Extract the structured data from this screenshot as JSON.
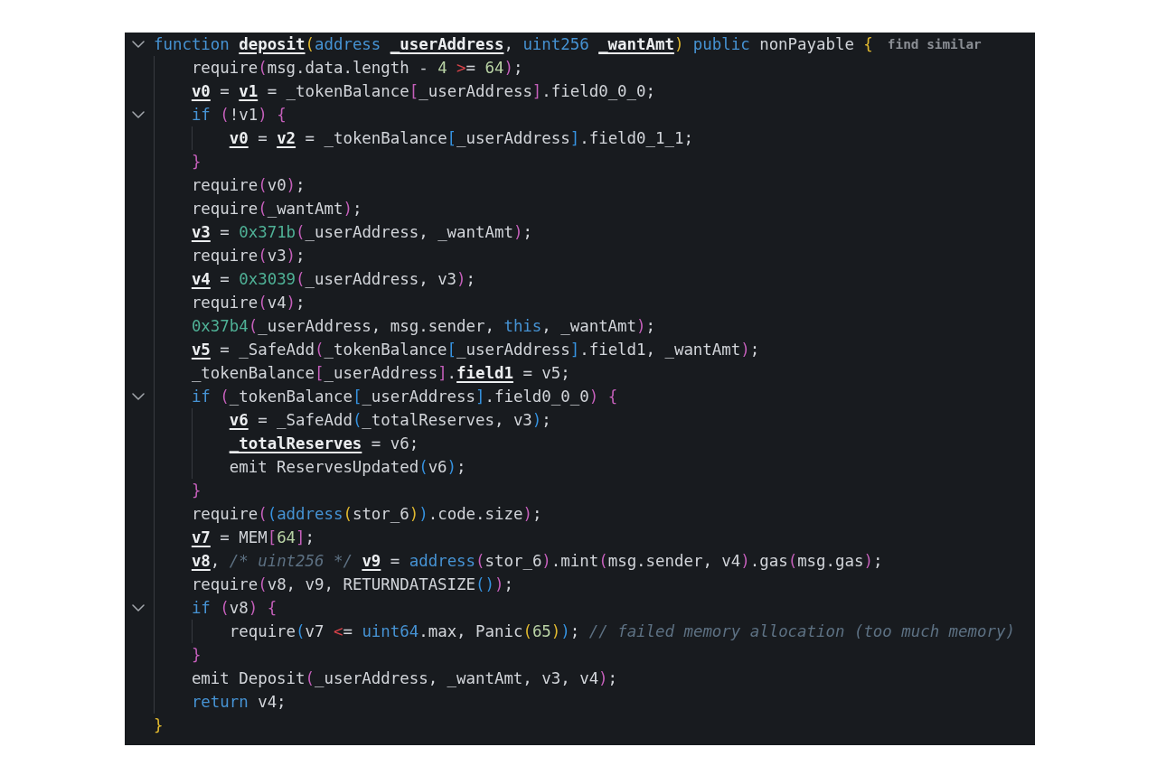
{
  "editor": {
    "lines": [
      {
        "expanded": true,
        "lens": "find similar",
        "tokens": [
          {
            "text": "function ",
            "kind": "keyword"
          },
          {
            "text": "deposit",
            "kind": "decl"
          },
          {
            "text": "(",
            "kind": "open"
          },
          {
            "text": "address ",
            "kind": "keyword"
          },
          {
            "text": "_userAddress",
            "kind": "decl"
          },
          {
            "text": ", ",
            "kind": "plain"
          },
          {
            "text": "uint256 ",
            "kind": "keyword"
          },
          {
            "text": "_wantAmt",
            "kind": "decl"
          },
          {
            "text": ")",
            "kind": "close"
          },
          {
            "text": " public",
            "kind": "keyword"
          },
          {
            "text": " nonPayable ",
            "kind": "plain"
          },
          {
            "text": "{",
            "kind": "open"
          }
        ],
        "children": [
          {
            "tokens": [
              {
                "text": "require",
                "kind": "plain"
              },
              {
                "text": "(",
                "kind": "open"
              },
              {
                "text": "msg.data.length - ",
                "kind": "plain"
              },
              {
                "text": "4 ",
                "kind": "number"
              },
              {
                "text": ">",
                "kind": "mismatch"
              },
              {
                "text": "= ",
                "kind": "plain"
              },
              {
                "text": "64",
                "kind": "number"
              },
              {
                "text": ")",
                "kind": "close"
              },
              {
                "text": ";",
                "kind": "plain"
              }
            ]
          },
          {
            "tokens": [
              {
                "text": "v0",
                "kind": "decl"
              },
              {
                "text": " = ",
                "kind": "plain"
              },
              {
                "text": "v1",
                "kind": "decl"
              },
              {
                "text": " = _tokenBalance",
                "kind": "plain"
              },
              {
                "text": "[",
                "kind": "open"
              },
              {
                "text": "_userAddress",
                "kind": "plain"
              },
              {
                "text": "]",
                "kind": "close"
              },
              {
                "text": ".field0_0_0;",
                "kind": "plain"
              }
            ]
          },
          {
            "expanded": true,
            "tokens": [
              {
                "text": "if ",
                "kind": "keyword"
              },
              {
                "text": "(",
                "kind": "open"
              },
              {
                "text": "!v1",
                "kind": "plain"
              },
              {
                "text": ")",
                "kind": "close"
              },
              {
                "text": " {",
                "kind": "open"
              }
            ],
            "children": [
              {
                "tokens": [
                  {
                    "text": "v0",
                    "kind": "decl"
                  },
                  {
                    "text": " = ",
                    "kind": "plain"
                  },
                  {
                    "text": "v2",
                    "kind": "decl"
                  },
                  {
                    "text": " = _tokenBalance",
                    "kind": "plain"
                  },
                  {
                    "text": "[",
                    "kind": "open"
                  },
                  {
                    "text": "_userAddress",
                    "kind": "plain"
                  },
                  {
                    "text": "]",
                    "kind": "close"
                  },
                  {
                    "text": ".field0_1_1;",
                    "kind": "plain"
                  }
                ]
              }
            ]
          },
          {
            "tokens": [
              {
                "text": "}",
                "kind": "close"
              }
            ]
          },
          {
            "tokens": [
              {
                "text": "require",
                "kind": "plain"
              },
              {
                "text": "(",
                "kind": "open"
              },
              {
                "text": "v0",
                "kind": "plain"
              },
              {
                "text": ")",
                "kind": "close"
              },
              {
                "text": ";",
                "kind": "plain"
              }
            ]
          },
          {
            "tokens": [
              {
                "text": "require",
                "kind": "plain"
              },
              {
                "text": "(",
                "kind": "open"
              },
              {
                "text": "_wantAmt",
                "kind": "plain"
              },
              {
                "text": ")",
                "kind": "close"
              },
              {
                "text": ";",
                "kind": "plain"
              }
            ]
          },
          {
            "tokens": [
              {
                "text": "v3",
                "kind": "decl"
              },
              {
                "text": " = ",
                "kind": "plain"
              },
              {
                "text": "0x371b",
                "kind": "call"
              },
              {
                "text": "(",
                "kind": "open"
              },
              {
                "text": "_userAddress, _wantAmt",
                "kind": "plain"
              },
              {
                "text": ")",
                "kind": "close"
              },
              {
                "text": ";",
                "kind": "plain"
              }
            ]
          },
          {
            "tokens": [
              {
                "text": "require",
                "kind": "plain"
              },
              {
                "text": "(",
                "kind": "open"
              },
              {
                "text": "v3",
                "kind": "plain"
              },
              {
                "text": ")",
                "kind": "close"
              },
              {
                "text": ";",
                "kind": "plain"
              }
            ]
          },
          {
            "tokens": [
              {
                "text": "v4",
                "kind": "decl"
              },
              {
                "text": " = ",
                "kind": "plain"
              },
              {
                "text": "0x3039",
                "kind": "call"
              },
              {
                "text": "(",
                "kind": "open"
              },
              {
                "text": "_userAddress, v3",
                "kind": "plain"
              },
              {
                "text": ")",
                "kind": "close"
              },
              {
                "text": ";",
                "kind": "plain"
              }
            ]
          },
          {
            "tokens": [
              {
                "text": "require",
                "kind": "plain"
              },
              {
                "text": "(",
                "kind": "open"
              },
              {
                "text": "v4",
                "kind": "plain"
              },
              {
                "text": ")",
                "kind": "close"
              },
              {
                "text": ";",
                "kind": "plain"
              }
            ]
          },
          {
            "tokens": [
              {
                "text": "0x37b4",
                "kind": "call"
              },
              {
                "text": "(",
                "kind": "open"
              },
              {
                "text": "_userAddress, msg.sender, ",
                "kind": "plain"
              },
              {
                "text": "this",
                "kind": "keyword"
              },
              {
                "text": ", _wantAmt",
                "kind": "plain"
              },
              {
                "text": ")",
                "kind": "close"
              },
              {
                "text": ";",
                "kind": "plain"
              }
            ]
          },
          {
            "tokens": [
              {
                "text": "v5",
                "kind": "decl"
              },
              {
                "text": " = _SafeAdd",
                "kind": "plain"
              },
              {
                "text": "(",
                "kind": "open"
              },
              {
                "text": "_tokenBalance",
                "kind": "plain"
              },
              {
                "text": "[",
                "kind": "open"
              },
              {
                "text": "_userAddress",
                "kind": "plain"
              },
              {
                "text": "]",
                "kind": "close"
              },
              {
                "text": ".field1, _wantAmt",
                "kind": "plain"
              },
              {
                "text": ")",
                "kind": "close"
              },
              {
                "text": ";",
                "kind": "plain"
              }
            ]
          },
          {
            "tokens": [
              {
                "text": "_tokenBalance",
                "kind": "plain"
              },
              {
                "text": "[",
                "kind": "open"
              },
              {
                "text": "_userAddress",
                "kind": "plain"
              },
              {
                "text": "]",
                "kind": "close"
              },
              {
                "text": ".",
                "kind": "plain"
              },
              {
                "text": "field1",
                "kind": "decl"
              },
              {
                "text": " = v5;",
                "kind": "plain"
              }
            ]
          },
          {
            "expanded": true,
            "tokens": [
              {
                "text": "if ",
                "kind": "keyword"
              },
              {
                "text": "(",
                "kind": "open"
              },
              {
                "text": "_tokenBalance",
                "kind": "plain"
              },
              {
                "text": "[",
                "kind": "open"
              },
              {
                "text": "_userAddress",
                "kind": "plain"
              },
              {
                "text": "]",
                "kind": "close"
              },
              {
                "text": ".field0_0_0",
                "kind": "plain"
              },
              {
                "text": ")",
                "kind": "close"
              },
              {
                "text": " {",
                "kind": "open"
              }
            ],
            "children": [
              {
                "tokens": [
                  {
                    "text": "v6",
                    "kind": "decl"
                  },
                  {
                    "text": " = _SafeAdd",
                    "kind": "plain"
                  },
                  {
                    "text": "(",
                    "kind": "open"
                  },
                  {
                    "text": "_totalReserves, v3",
                    "kind": "plain"
                  },
                  {
                    "text": ")",
                    "kind": "close"
                  },
                  {
                    "text": ";",
                    "kind": "plain"
                  }
                ]
              },
              {
                "tokens": [
                  {
                    "text": "_totalReserves",
                    "kind": "decl"
                  },
                  {
                    "text": " = v6;",
                    "kind": "plain"
                  }
                ]
              },
              {
                "tokens": [
                  {
                    "text": "emit ReservesUpdated",
                    "kind": "plain"
                  },
                  {
                    "text": "(",
                    "kind": "open"
                  },
                  {
                    "text": "v6",
                    "kind": "plain"
                  },
                  {
                    "text": ")",
                    "kind": "close"
                  },
                  {
                    "text": ";",
                    "kind": "plain"
                  }
                ]
              }
            ]
          },
          {
            "tokens": [
              {
                "text": "}",
                "kind": "close"
              }
            ]
          },
          {
            "tokens": [
              {
                "text": "require",
                "kind": "plain"
              },
              {
                "text": "(",
                "kind": "open"
              },
              {
                "text": "(",
                "kind": "open"
              },
              {
                "text": "address",
                "kind": "keyword"
              },
              {
                "text": "(",
                "kind": "open"
              },
              {
                "text": "stor_6",
                "kind": "plain"
              },
              {
                "text": ")",
                "kind": "close"
              },
              {
                "text": ")",
                "kind": "close"
              },
              {
                "text": ".code.size",
                "kind": "plain"
              },
              {
                "text": ")",
                "kind": "close"
              },
              {
                "text": ";",
                "kind": "plain"
              }
            ]
          },
          {
            "tokens": [
              {
                "text": "v7",
                "kind": "decl"
              },
              {
                "text": " = MEM",
                "kind": "plain"
              },
              {
                "text": "[",
                "kind": "open"
              },
              {
                "text": "64",
                "kind": "number"
              },
              {
                "text": "]",
                "kind": "close"
              },
              {
                "text": ";",
                "kind": "plain"
              }
            ]
          },
          {
            "tokens": [
              {
                "text": "v8",
                "kind": "decl"
              },
              {
                "text": ", ",
                "kind": "plain"
              },
              {
                "text": "/* uint256 */ ",
                "kind": "comment"
              },
              {
                "text": "v9",
                "kind": "decl"
              },
              {
                "text": " = ",
                "kind": "plain"
              },
              {
                "text": "address",
                "kind": "keyword"
              },
              {
                "text": "(",
                "kind": "open"
              },
              {
                "text": "stor_6",
                "kind": "plain"
              },
              {
                "text": ")",
                "kind": "close"
              },
              {
                "text": ".mint",
                "kind": "plain"
              },
              {
                "text": "(",
                "kind": "open"
              },
              {
                "text": "msg.sender, v4",
                "kind": "plain"
              },
              {
                "text": ")",
                "kind": "close"
              },
              {
                "text": ".gas",
                "kind": "plain"
              },
              {
                "text": "(",
                "kind": "open"
              },
              {
                "text": "msg.gas",
                "kind": "plain"
              },
              {
                "text": ")",
                "kind": "close"
              },
              {
                "text": ";",
                "kind": "plain"
              }
            ]
          },
          {
            "tokens": [
              {
                "text": "require",
                "kind": "plain"
              },
              {
                "text": "(",
                "kind": "open"
              },
              {
                "text": "v8, v9, RETURNDATASIZE",
                "kind": "plain"
              },
              {
                "text": "(",
                "kind": "open"
              },
              {
                "text": ")",
                "kind": "close"
              },
              {
                "text": ")",
                "kind": "close"
              },
              {
                "text": ";",
                "kind": "plain"
              }
            ]
          },
          {
            "expanded": true,
            "tokens": [
              {
                "text": "if ",
                "kind": "keyword"
              },
              {
                "text": "(",
                "kind": "open"
              },
              {
                "text": "v8",
                "kind": "plain"
              },
              {
                "text": ")",
                "kind": "close"
              },
              {
                "text": " {",
                "kind": "open"
              }
            ],
            "children": [
              {
                "tokens": [
                  {
                    "text": "require",
                    "kind": "plain"
                  },
                  {
                    "text": "(",
                    "kind": "open"
                  },
                  {
                    "text": "v7 ",
                    "kind": "plain"
                  },
                  {
                    "text": "<",
                    "kind": "mismatch"
                  },
                  {
                    "text": "= ",
                    "kind": "plain"
                  },
                  {
                    "text": "uint64",
                    "kind": "keyword"
                  },
                  {
                    "text": ".max, Panic",
                    "kind": "plain"
                  },
                  {
                    "text": "(",
                    "kind": "open"
                  },
                  {
                    "text": "65",
                    "kind": "number"
                  },
                  {
                    "text": ")",
                    "kind": "close"
                  },
                  {
                    "text": ")",
                    "kind": "close"
                  },
                  {
                    "text": "; ",
                    "kind": "plain"
                  },
                  {
                    "text": "// failed memory allocation (too much memory)",
                    "kind": "comment"
                  }
                ]
              }
            ]
          },
          {
            "tokens": [
              {
                "text": "}",
                "kind": "close"
              }
            ]
          },
          {
            "tokens": [
              {
                "text": "emit Deposit",
                "kind": "plain"
              },
              {
                "text": "(",
                "kind": "open"
              },
              {
                "text": "_userAddress, _wantAmt, v3, v4",
                "kind": "plain"
              },
              {
                "text": ")",
                "kind": "close"
              },
              {
                "text": ";",
                "kind": "plain"
              }
            ]
          },
          {
            "tokens": [
              {
                "text": "return",
                "kind": "keyword"
              },
              {
                "text": " v4;",
                "kind": "plain"
              }
            ]
          }
        ]
      },
      {
        "tokens": [
          {
            "text": "}",
            "kind": "close"
          }
        ]
      }
    ]
  }
}
